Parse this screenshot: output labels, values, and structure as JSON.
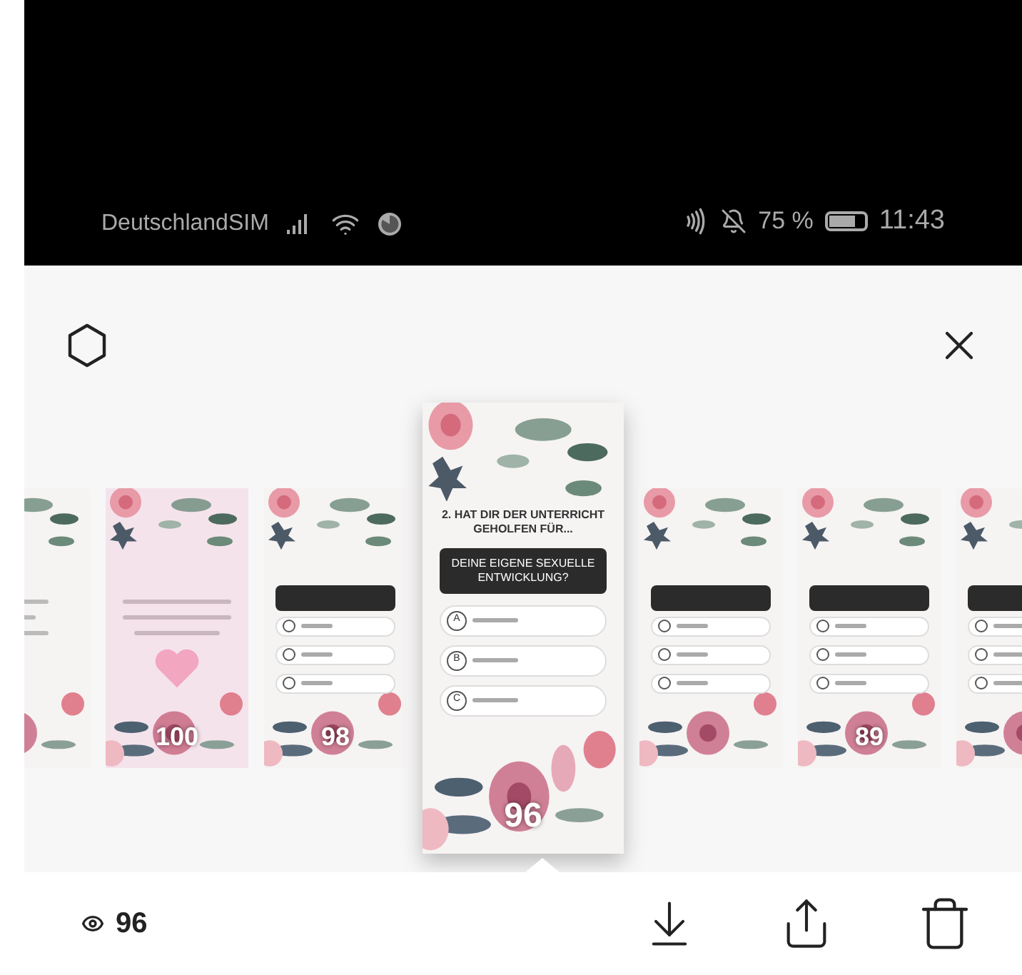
{
  "status_bar": {
    "carrier": "DeutschlandSIM",
    "battery": "75 %",
    "time": "11:43"
  },
  "stories": [
    {
      "kind": "text",
      "selected": false
    },
    {
      "kind": "thanks",
      "selected": false,
      "number": "100"
    },
    {
      "kind": "quiz",
      "selected": false,
      "number": "98"
    },
    {
      "kind": "quiz",
      "selected": true,
      "heading": "2. HAT DIR DER UNTERRICHT GEHOLFEN FÜR...",
      "question": "DEINE EIGENE SEXUELLE ENTWICKLUNG?",
      "options": [
        "A",
        "B",
        "C"
      ],
      "number": "96"
    },
    {
      "kind": "quiz",
      "selected": false
    },
    {
      "kind": "quiz",
      "selected": false,
      "number": "89"
    },
    {
      "kind": "quiz",
      "selected": false
    }
  ],
  "viewers": "96"
}
